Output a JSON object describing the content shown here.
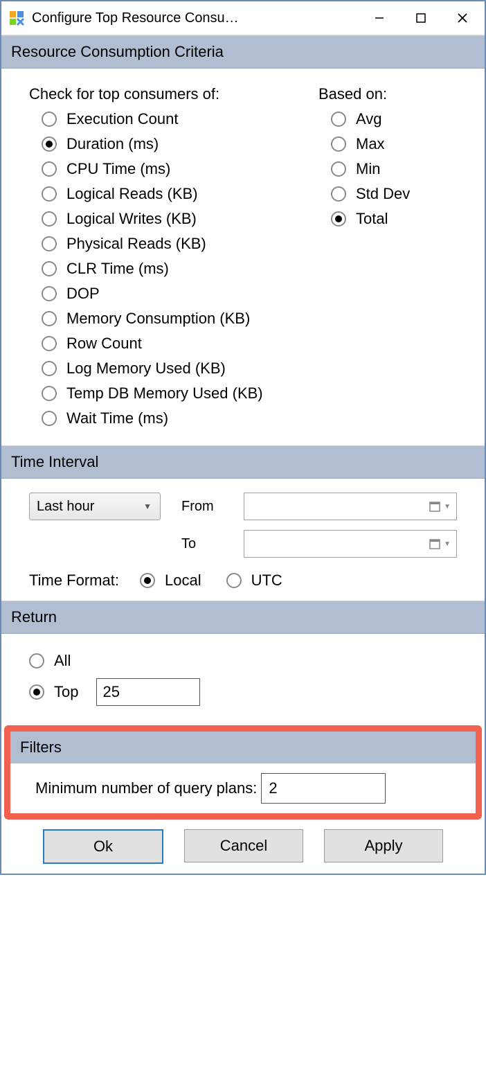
{
  "title": "Configure Top Resource Consu…",
  "sections": {
    "criteria_header": "Resource Consumption Criteria",
    "consumers_label": "Check for top consumers of:",
    "based_on_label": "Based on:",
    "time_header": "Time Interval",
    "return_header": "Return",
    "filters_header": "Filters"
  },
  "consumers": [
    {
      "label": "Execution Count",
      "selected": false
    },
    {
      "label": "Duration (ms)",
      "selected": true
    },
    {
      "label": "CPU Time (ms)",
      "selected": false
    },
    {
      "label": "Logical Reads (KB)",
      "selected": false
    },
    {
      "label": "Logical Writes (KB)",
      "selected": false
    },
    {
      "label": "Physical Reads (KB)",
      "selected": false
    },
    {
      "label": "CLR Time (ms)",
      "selected": false
    },
    {
      "label": "DOP",
      "selected": false
    },
    {
      "label": "Memory Consumption (KB)",
      "selected": false
    },
    {
      "label": "Row Count",
      "selected": false
    },
    {
      "label": "Log Memory Used (KB)",
      "selected": false
    },
    {
      "label": "Temp DB Memory Used (KB)",
      "selected": false
    },
    {
      "label": "Wait Time (ms)",
      "selected": false
    }
  ],
  "based_on": [
    {
      "label": "Avg",
      "selected": false
    },
    {
      "label": "Max",
      "selected": false
    },
    {
      "label": "Min",
      "selected": false
    },
    {
      "label": "Std Dev",
      "selected": false
    },
    {
      "label": "Total",
      "selected": true
    }
  ],
  "time_interval": {
    "preset": "Last hour",
    "from_label": "From",
    "to_label": "To",
    "from_value": "",
    "to_value": "",
    "format_label": "Time Format:",
    "formats": [
      {
        "label": "Local",
        "selected": true
      },
      {
        "label": "UTC",
        "selected": false
      }
    ]
  },
  "return": {
    "all_label": "All",
    "all_selected": false,
    "top_label": "Top",
    "top_selected": true,
    "top_value": "25"
  },
  "filters": {
    "label": "Minimum number of query plans:",
    "value": "2"
  },
  "buttons": {
    "ok": "Ok",
    "cancel": "Cancel",
    "apply": "Apply"
  }
}
